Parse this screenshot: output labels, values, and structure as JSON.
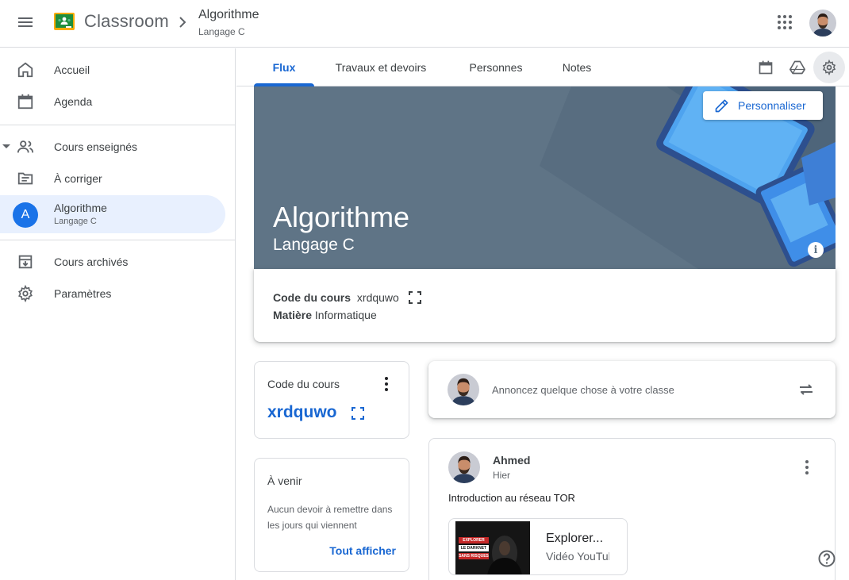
{
  "app": {
    "brand": "Classroom",
    "colors": {
      "accent": "#1967d2",
      "banner": "#5f7486",
      "active_bg": "#e8f0fe"
    }
  },
  "breadcrumb": {
    "title": "Algorithme",
    "subtitle": "Langage C"
  },
  "icons": {
    "menu": "menu-icon",
    "apps": "apps-grid-icon",
    "home": "home-icon",
    "calendar": "calendar-icon",
    "people": "people-icon",
    "review": "folder-review-icon",
    "archive": "archive-icon",
    "settings": "gear-icon",
    "drive": "drive-icon",
    "edit": "pencil-icon",
    "info": "info-icon",
    "more": "more-vert-icon",
    "expand": "fullscreen-icon",
    "repost": "repost-icon",
    "help": "help-icon"
  },
  "sidebar": {
    "home": "Accueil",
    "calendar": "Agenda",
    "teaching": "Cours enseignés",
    "to_review": "À corriger",
    "active_course": {
      "initial": "A",
      "name": "Algorithme",
      "section": "Langage C"
    },
    "archived": "Cours archivés",
    "settings": "Paramètres"
  },
  "tabs": {
    "stream": "Flux",
    "classwork": "Travaux et devoirs",
    "people": "Personnes",
    "grades": "Notes"
  },
  "banner": {
    "title": "Algorithme",
    "subtitle": "Langage C",
    "customize": "Personnaliser",
    "info": "i"
  },
  "details": {
    "code_label": "Code du cours",
    "code_value": "xrdquwo",
    "subject_label": "Matière",
    "subject_value": "Informatique"
  },
  "code_card": {
    "title": "Code du cours",
    "code": "xrdquwo"
  },
  "upcoming": {
    "title": "À venir",
    "text": "Aucun devoir à remettre dans les jours qui viennent",
    "link": "Tout afficher"
  },
  "announce": {
    "placeholder": "Annoncez quelque chose à votre classe"
  },
  "post": {
    "author": "Ahmed",
    "time": "Hier",
    "text": "Introduction au réseau TOR",
    "attachment": {
      "title": "Explorer...",
      "type": "Vidéo YouTube",
      "thumb_lines": [
        "EXPLORER",
        "LE DARKNET",
        "SANS RISQUES"
      ]
    }
  }
}
